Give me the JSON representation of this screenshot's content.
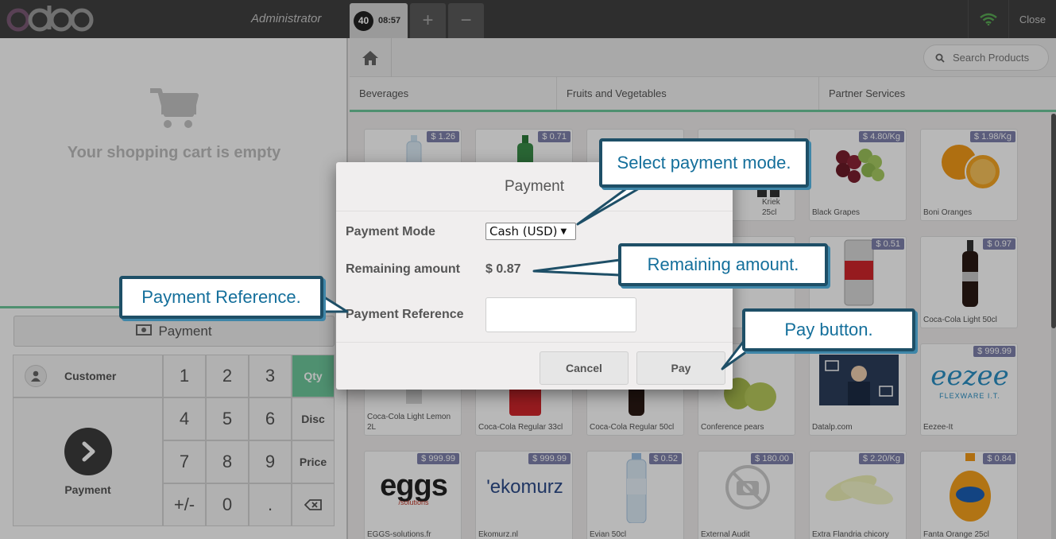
{
  "topbar": {
    "logo": "odoo",
    "user": "Administrator",
    "order_number": "40",
    "order_time": "08:57",
    "add_label": "+",
    "remove_label": "−",
    "close_label": "Close"
  },
  "cart": {
    "empty_text": "Your shopping cart is empty",
    "payment_label": "Payment"
  },
  "numpad": {
    "customer_label": "Customer",
    "payment_label": "Payment",
    "keys": [
      "1",
      "2",
      "3",
      "Qty",
      "4",
      "5",
      "6",
      "Disc",
      "7",
      "8",
      "9",
      "Price",
      "+/-",
      "0",
      "."
    ],
    "selected_mode": "Qty"
  },
  "search": {
    "placeholder": "Search Products"
  },
  "categories": [
    "Beverages",
    "Fruits and Vegetables",
    "Partner Services"
  ],
  "products": [
    {
      "name": "",
      "price": "$ 1.26"
    },
    {
      "name": "",
      "price": "$ 0.71"
    },
    {
      "name": "",
      "price": ""
    },
    {
      "name": "Kriek 25cl",
      "price": ""
    },
    {
      "name": "Black Grapes",
      "price": "$ 4.80/Kg"
    },
    {
      "name": "Boni Oranges",
      "price": "$ 1.98/Kg"
    },
    {
      "name": "",
      "price": ""
    },
    {
      "name": "",
      "price": ""
    },
    {
      "name": "",
      "price": ""
    },
    {
      "name": "",
      "price": ""
    },
    {
      "name": "",
      "price": "$ 0.51"
    },
    {
      "name": "Coca-Cola Light 50cl",
      "price": "$ 0.97"
    },
    {
      "name": "Coca-Cola Light Lemon 2L",
      "price": ""
    },
    {
      "name": "Coca-Cola Regular 33cl",
      "price": ""
    },
    {
      "name": "Coca-Cola Regular 50cl",
      "price": ""
    },
    {
      "name": "Conference pears",
      "price": ""
    },
    {
      "name": "Datalp.com",
      "price": ""
    },
    {
      "name": "Eezee-It",
      "price": "$ 999.99"
    },
    {
      "name": "EGGS-solutions.fr",
      "price": "$ 999.99"
    },
    {
      "name": "Ekomurz.nl",
      "price": "$ 999.99"
    },
    {
      "name": "Evian 50cl",
      "price": "$ 0.52"
    },
    {
      "name": "External Audit",
      "price": "$ 180.00"
    },
    {
      "name": "Extra Flandria chicory",
      "price": "$ 2.20/Kg"
    },
    {
      "name": "Fanta Orange 25cl",
      "price": "$ 0.84"
    }
  ],
  "product_logos": {
    "eggs": "eggs",
    "eggs_sub": "/solutions",
    "ekomurz": "'ekomurz",
    "eezee": "eezee",
    "eezee_sub": "FLEXWARE I.T.",
    "fanta": "Fanta",
    "coca": "Coca-Cola"
  },
  "dialog": {
    "title": "Payment",
    "mode_label": "Payment Mode",
    "mode_value": "Cash (USD)",
    "remaining_label": "Remaining amount",
    "remaining_value": "$ 0.87",
    "reference_label": "Payment Reference",
    "reference_value": "",
    "cancel_label": "Cancel",
    "pay_label": "Pay"
  },
  "callouts": {
    "select_mode": "Select payment mode.",
    "remaining": "Remaining amount.",
    "reference": "Payment Reference.",
    "pay": "Pay button."
  },
  "colors": {
    "topbar": "#414141",
    "accent_green": "#6ec89b",
    "price_badge": "#7f82ac",
    "callout_border": "#1e4f67",
    "callout_text": "#146f9b"
  }
}
